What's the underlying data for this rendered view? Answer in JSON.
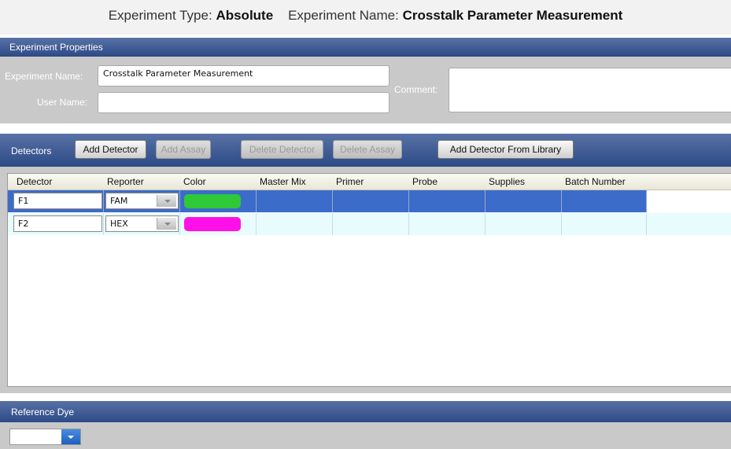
{
  "header": {
    "type_label": "Experiment Type:",
    "type_value": "Absolute",
    "name_label": "Experiment Name:",
    "name_value": "Crosstalk Parameter Measurement"
  },
  "properties": {
    "section_title": "Experiment Properties",
    "experiment_name_label": "Experiment Name:",
    "experiment_name_value": "Crosstalk Parameter Measurement",
    "user_name_label": "User Name:",
    "user_name_value": "",
    "comment_label": "Comment:",
    "comment_value": ""
  },
  "detectors": {
    "section_title": "Detectors",
    "buttons": {
      "add_detector": "Add Detector",
      "add_assay": "Add Assay",
      "delete_detector": "Delete Detector",
      "delete_assay": "Delete Assay",
      "add_from_library": "Add Detector From Library"
    },
    "columns": [
      "Detector",
      "Reporter",
      "Color",
      "Master Mix",
      "Primer",
      "Probe",
      "Supplies",
      "Batch Number"
    ],
    "rows": [
      {
        "detector": "F1",
        "reporter": "FAM",
        "color": "#2fc837",
        "selected": true
      },
      {
        "detector": "F2",
        "reporter": "HEX",
        "color": "#ff10e8",
        "selected": false
      }
    ]
  },
  "reference_dye": {
    "section_title": "Reference Dye",
    "value": ""
  },
  "colors": {
    "band": "#2d4a86",
    "selected_row": "#3b6cc9",
    "alt_row": "#e8fbfd"
  }
}
